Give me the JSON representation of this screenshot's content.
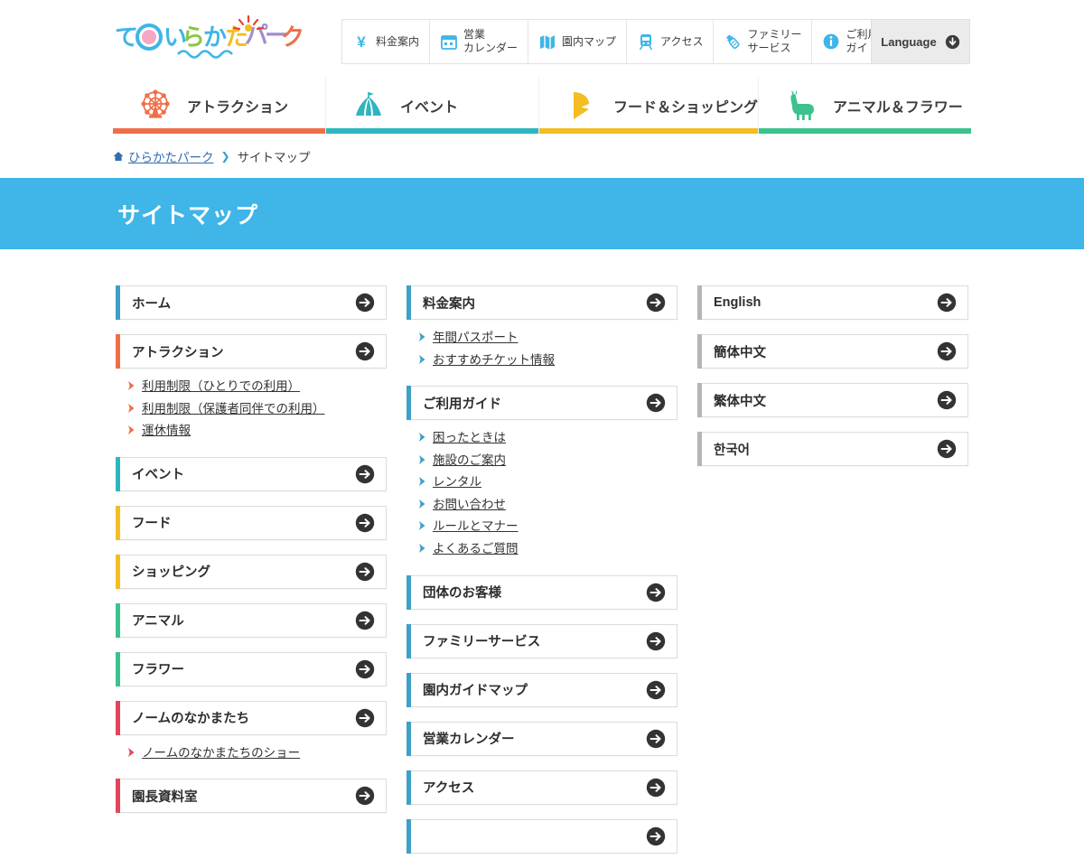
{
  "header": {
    "logo_alt": "ひらかたパーク",
    "utils": [
      {
        "label": "料金案内",
        "icon": "yen-icon"
      },
      {
        "label": "営業\nカレンダー",
        "icon": "calendar-icon"
      },
      {
        "label": "園内マップ",
        "icon": "map-icon"
      },
      {
        "label": "アクセス",
        "icon": "train-icon"
      },
      {
        "label": "ファミリー\nサービス",
        "icon": "baby-bottle-icon"
      },
      {
        "label": "ご利用\nガイド",
        "icon": "info-icon"
      }
    ],
    "language_button": {
      "label": "Language",
      "icon": "down-arrow-circle-icon"
    }
  },
  "gnav": [
    {
      "label": "アトラクション",
      "icon": "ferris-wheel-icon",
      "color": "#ef6f48"
    },
    {
      "label": "イベント",
      "icon": "circus-tent-icon",
      "color": "#2eb6bf"
    },
    {
      "label": "フード＆ショッピング",
      "icon": "food-cone-icon",
      "color": "#f3bd23"
    },
    {
      "label": "アニマル＆フラワー",
      "icon": "alpaca-icon",
      "color": "#3cc28d"
    }
  ],
  "breadcrumb": {
    "home_icon": "home-icon",
    "home_label": "ひらかたパーク",
    "separator": "❯",
    "current": "サイトマップ"
  },
  "page_title": "サイトマップ",
  "colors": {
    "banner": "#3fb5e8",
    "accent_blue": "#3f9fc9",
    "accent_orange": "#ef6f48",
    "accent_teal": "#2eb6bf",
    "accent_yellow": "#f3bd23",
    "accent_green": "#3cc28d",
    "accent_red": "#e2455b",
    "accent_gray": "#b5b5b5",
    "link_text": "#333333"
  },
  "sitemap": {
    "columns": [
      {
        "name": "column-left",
        "groups": [
          {
            "title": "ホーム",
            "accent": "#3f9fc9",
            "chevron": "#ef6f48",
            "links": []
          },
          {
            "title": "アトラクション",
            "accent": "#ef6f48",
            "chevron": "#ef6f48",
            "links": [
              "利用制限（ひとりでの利用）",
              "利用制限（保護者同伴での利用）",
              "運休情報"
            ]
          },
          {
            "title": "イベント",
            "accent": "#2eb6bf",
            "chevron": "#ef6f48",
            "links": []
          },
          {
            "title": "フード",
            "accent": "#f3bd23",
            "chevron": "#ef6f48",
            "links": []
          },
          {
            "title": "ショッピング",
            "accent": "#f3bd23",
            "chevron": "#ef6f48",
            "links": []
          },
          {
            "title": "アニマル",
            "accent": "#3cc28d",
            "chevron": "#ef6f48",
            "links": []
          },
          {
            "title": "フラワー",
            "accent": "#3cc28d",
            "chevron": "#ef6f48",
            "links": []
          },
          {
            "title": "ノームのなかまたち",
            "accent": "#e2455b",
            "chevron": "#e2455b",
            "links": [
              "ノームのなかまたちのショー"
            ]
          },
          {
            "title": "園長資料室",
            "accent": "#e2455b",
            "chevron": "#e2455b",
            "links": []
          }
        ]
      },
      {
        "name": "column-middle",
        "groups": [
          {
            "title": "料金案内",
            "accent": "#3f9fc9",
            "chevron": "#3f9fc9",
            "links": [
              "年間パスポート",
              "おすすめチケット情報"
            ]
          },
          {
            "title": "ご利用ガイド",
            "accent": "#3f9fc9",
            "chevron": "#3f9fc9",
            "links": [
              "困ったときは",
              "施設のご案内",
              "レンタル",
              "お問い合わせ",
              "ルールとマナー",
              "よくあるご質問"
            ]
          },
          {
            "title": "団体のお客様",
            "accent": "#3f9fc9",
            "chevron": "#3f9fc9",
            "links": []
          },
          {
            "title": "ファミリーサービス",
            "accent": "#3f9fc9",
            "chevron": "#3f9fc9",
            "links": []
          },
          {
            "title": "園内ガイドマップ",
            "accent": "#3f9fc9",
            "chevron": "#3f9fc9",
            "links": []
          },
          {
            "title": "営業カレンダー",
            "accent": "#3f9fc9",
            "chevron": "#3f9fc9",
            "links": []
          },
          {
            "title": "アクセス",
            "accent": "#3f9fc9",
            "chevron": "#3f9fc9",
            "links": []
          },
          {
            "title": "",
            "accent": "#3f9fc9",
            "chevron": "#3f9fc9",
            "links": []
          }
        ]
      },
      {
        "name": "column-right",
        "groups": [
          {
            "title": "English",
            "accent": "#b5b5b5",
            "chevron": "#b5b5b5",
            "links": []
          },
          {
            "title": "簡体中文",
            "accent": "#b5b5b5",
            "chevron": "#b5b5b5",
            "links": []
          },
          {
            "title": "繁体中文",
            "accent": "#b5b5b5",
            "chevron": "#b5b5b5",
            "links": []
          },
          {
            "title": "한국어",
            "accent": "#b5b5b5",
            "chevron": "#b5b5b5",
            "links": []
          }
        ]
      }
    ]
  }
}
